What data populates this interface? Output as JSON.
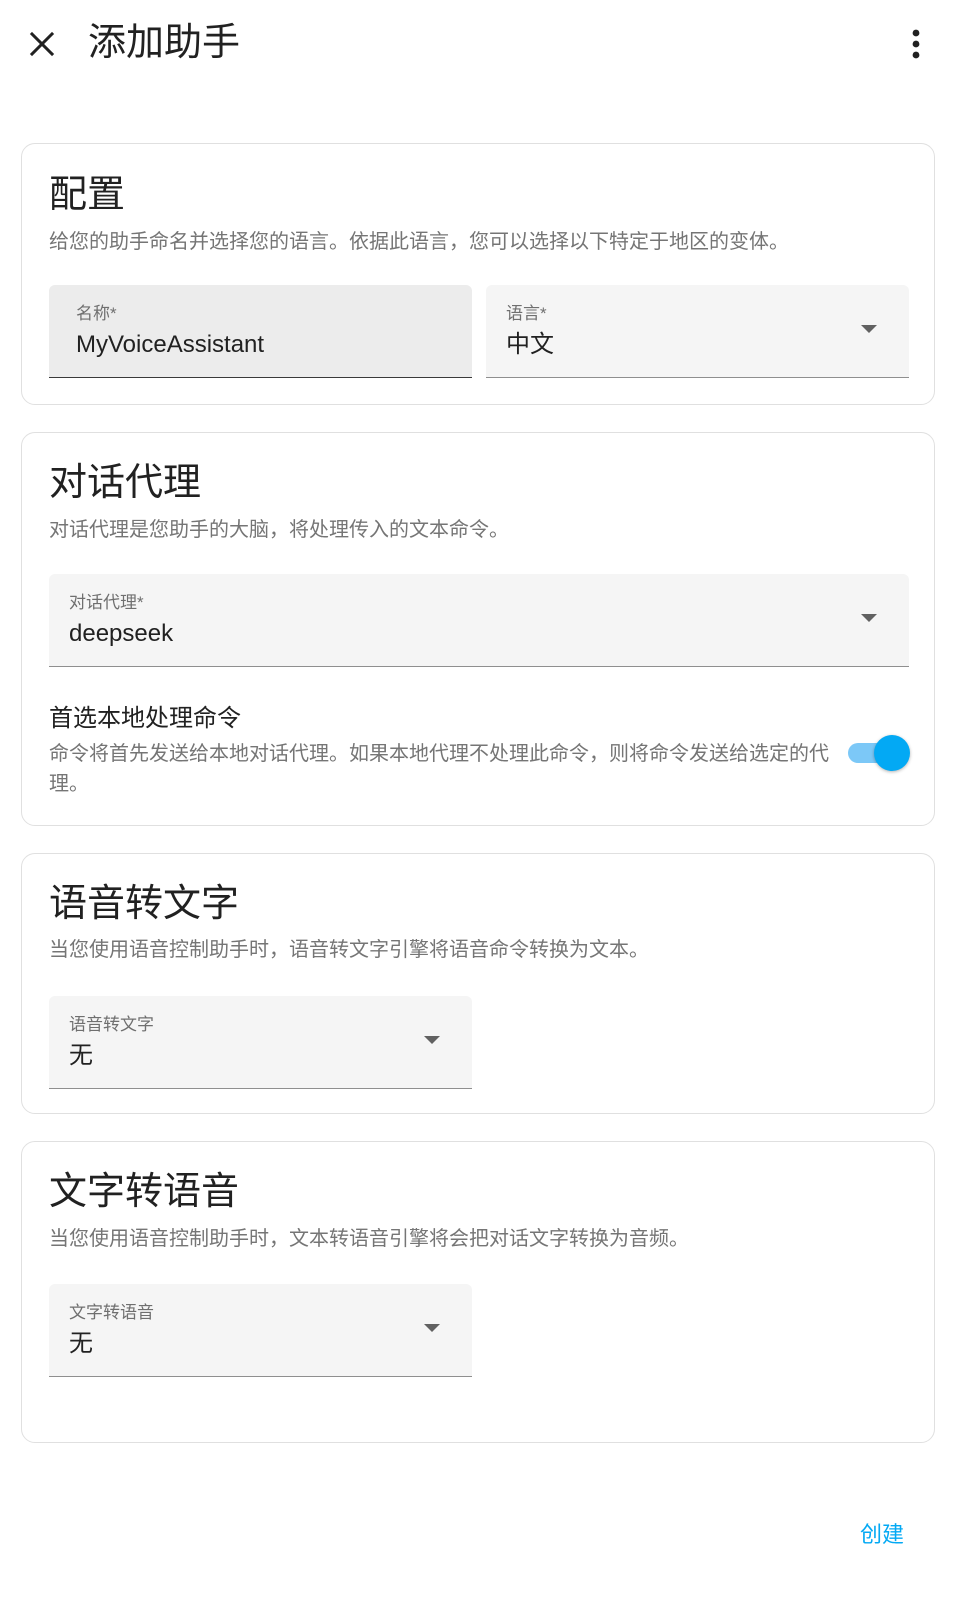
{
  "header": {
    "title": "添加助手",
    "close_icon": "close-icon",
    "more_icon": "more-vertical-icon"
  },
  "config": {
    "title": "配置",
    "description": "给您的助手命名并选择您的语言。依据此语言，您可以选择以下特定于地区的变体。",
    "name_field": {
      "label": "名称*",
      "value": "MyVoiceAssistant"
    },
    "language_field": {
      "label": "语言*",
      "value": "中文"
    }
  },
  "conversation": {
    "title": "对话代理",
    "description": "对话代理是您助手的大脑，将处理传入的文本命令。",
    "agent_field": {
      "label": "对话代理*",
      "value": "deepseek"
    },
    "prefer_local": {
      "title": "首选本地处理命令",
      "description": "命令将首先发送给本地对话代理。如果本地代理不处理此命令，则将命令发送给选定的代理。",
      "enabled": true
    }
  },
  "stt": {
    "title": "语音转文字",
    "description": "当您使用语音控制助手时，语音转文字引擎将语音命令转换为文本。",
    "field": {
      "label": "语音转文字",
      "value": "无"
    }
  },
  "tts": {
    "title": "文字转语音",
    "description": "当您使用语音控制助手时，文本转语音引擎将会把对话文字转换为音频。",
    "field": {
      "label": "文字转语音",
      "value": "无"
    }
  },
  "actions": {
    "create_label": "创建"
  },
  "colors": {
    "accent": "#03a9f4",
    "accent_light": "#7cc8f7"
  }
}
